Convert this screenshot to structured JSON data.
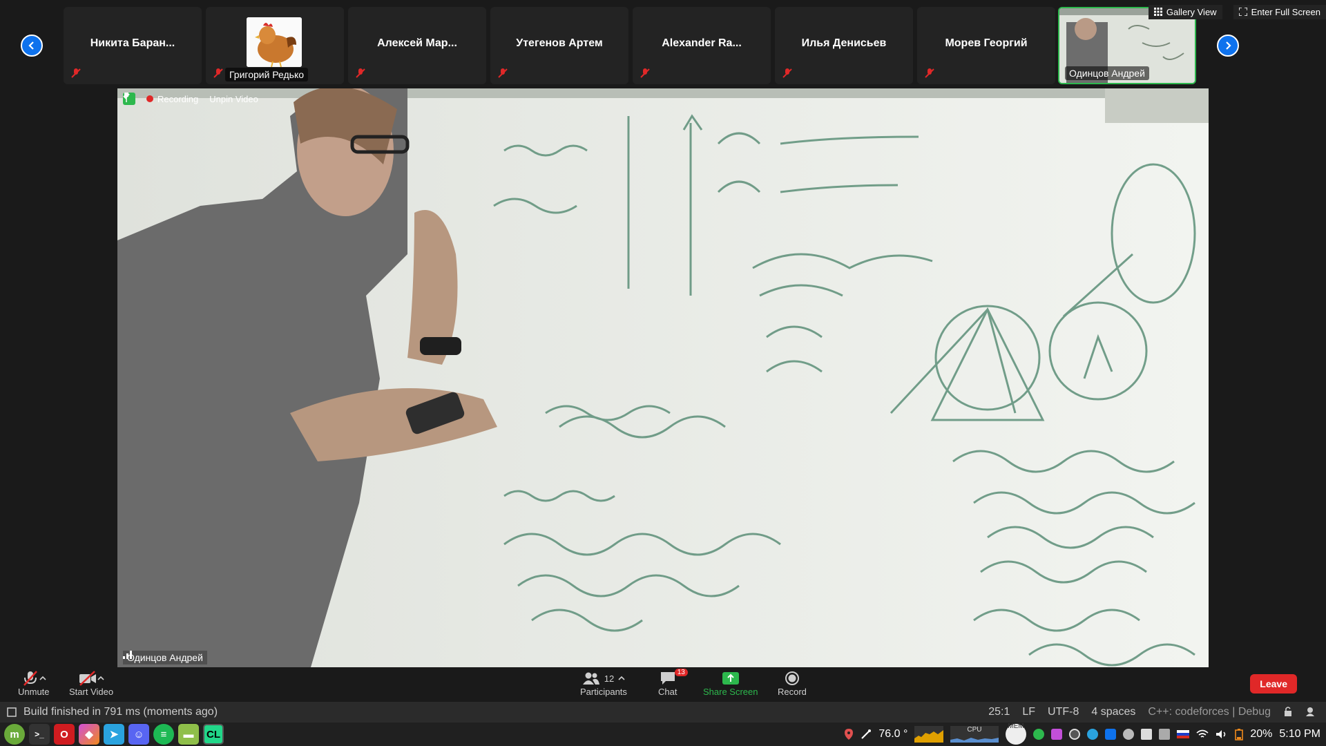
{
  "participants": [
    {
      "name": "Никита Баран..."
    },
    {
      "name": "Григорий Редько"
    },
    {
      "name": "Алексей Мар..."
    },
    {
      "name": "Утегенов Артем"
    },
    {
      "name": "Alexander Ra..."
    },
    {
      "name": "Илья Денисьев"
    },
    {
      "name": "Морев Георгий"
    },
    {
      "name": "Одинцов Андрей"
    }
  ],
  "top_buttons": {
    "gallery": "Gallery View",
    "fullscreen": "Enter Full Screen"
  },
  "video": {
    "recording": "Recording",
    "unpin": "Unpin Video",
    "speaker": "Одинцов Андрей"
  },
  "controls": {
    "unmute": "Unmute",
    "start_video": "Start Video",
    "participants": "Participants",
    "participants_count": "12",
    "chat": "Chat",
    "chat_badge": "13",
    "share_screen": "Share Screen",
    "record": "Record",
    "leave": "Leave"
  },
  "statusbar": {
    "message": "Build finished in 791 ms (moments ago)",
    "position": "25:1",
    "line_ending": "LF",
    "encoding": "UTF-8",
    "indent": "4 spaces",
    "context": "C++: codeforces | Debug"
  },
  "taskbar": {
    "temperature": "76.0 °",
    "cpu": "CPU",
    "mem": "MEM",
    "battery": "20%",
    "time": "5:10 PM"
  },
  "colors": {
    "accent_green": "#2db84d",
    "zoom_blue": "#0e72ed",
    "leave_red": "#e02828"
  }
}
